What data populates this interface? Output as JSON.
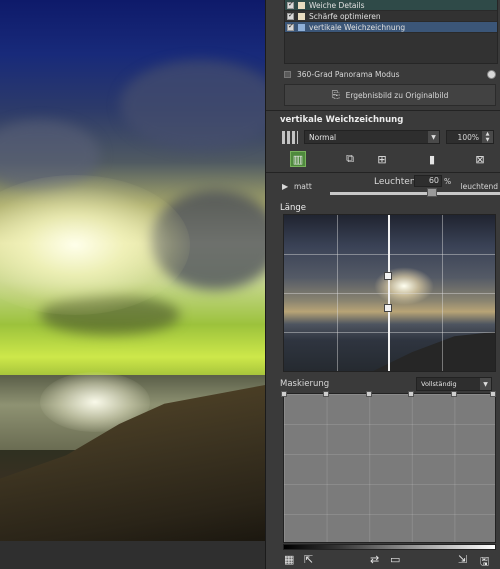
{
  "effects_list": [
    {
      "label": "Weiche Details",
      "checked": true,
      "swatch": "#e8dcc0",
      "state": "first"
    },
    {
      "label": "Schärfe optimieren",
      "checked": true,
      "swatch": "#e8dcc0",
      "state": "normal"
    },
    {
      "label": "vertikale Weichzeichnung",
      "checked": true,
      "swatch": "#8fb0d8",
      "state": "selected"
    }
  ],
  "panorama": {
    "label": "360-Grad Panorama Modus",
    "checked": false
  },
  "original_button": {
    "label": "Ergebnisbild zu Originalbild"
  },
  "section": {
    "title": "vertikale Weichzeichnung"
  },
  "blend": {
    "mode": "Normal",
    "opacity": "100%"
  },
  "slider": {
    "left_label": "matt",
    "name": "Leuchten",
    "value": "60",
    "unit": "%",
    "right_label": "leuchtend",
    "level_percent": 60
  },
  "length": {
    "title": "Länge"
  },
  "mask": {
    "title": "Maskierung",
    "mode": "Vollständig"
  },
  "icons": {
    "mask_tool": "mask-icon",
    "copy_tool": "copy-icon",
    "paste_tool": "paste-icon",
    "gradient_tool": "gradient-icon",
    "delete_tool": "delete-icon"
  }
}
